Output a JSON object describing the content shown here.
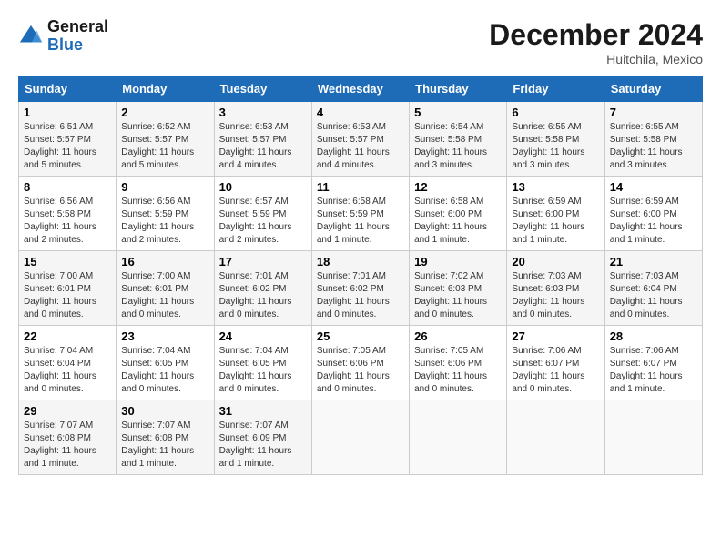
{
  "header": {
    "logo_general": "General",
    "logo_blue": "Blue",
    "month_title": "December 2024",
    "location": "Huitchila, Mexico"
  },
  "weekdays": [
    "Sunday",
    "Monday",
    "Tuesday",
    "Wednesday",
    "Thursday",
    "Friday",
    "Saturday"
  ],
  "weeks": [
    [
      {
        "day": "1",
        "sunrise": "6:51 AM",
        "sunset": "5:57 PM",
        "daylight": "11 hours and 5 minutes."
      },
      {
        "day": "2",
        "sunrise": "6:52 AM",
        "sunset": "5:57 PM",
        "daylight": "11 hours and 5 minutes."
      },
      {
        "day": "3",
        "sunrise": "6:53 AM",
        "sunset": "5:57 PM",
        "daylight": "11 hours and 4 minutes."
      },
      {
        "day": "4",
        "sunrise": "6:53 AM",
        "sunset": "5:57 PM",
        "daylight": "11 hours and 4 minutes."
      },
      {
        "day": "5",
        "sunrise": "6:54 AM",
        "sunset": "5:58 PM",
        "daylight": "11 hours and 3 minutes."
      },
      {
        "day": "6",
        "sunrise": "6:55 AM",
        "sunset": "5:58 PM",
        "daylight": "11 hours and 3 minutes."
      },
      {
        "day": "7",
        "sunrise": "6:55 AM",
        "sunset": "5:58 PM",
        "daylight": "11 hours and 3 minutes."
      }
    ],
    [
      {
        "day": "8",
        "sunrise": "6:56 AM",
        "sunset": "5:58 PM",
        "daylight": "11 hours and 2 minutes."
      },
      {
        "day": "9",
        "sunrise": "6:56 AM",
        "sunset": "5:59 PM",
        "daylight": "11 hours and 2 minutes."
      },
      {
        "day": "10",
        "sunrise": "6:57 AM",
        "sunset": "5:59 PM",
        "daylight": "11 hours and 2 minutes."
      },
      {
        "day": "11",
        "sunrise": "6:58 AM",
        "sunset": "5:59 PM",
        "daylight": "11 hours and 1 minute."
      },
      {
        "day": "12",
        "sunrise": "6:58 AM",
        "sunset": "6:00 PM",
        "daylight": "11 hours and 1 minute."
      },
      {
        "day": "13",
        "sunrise": "6:59 AM",
        "sunset": "6:00 PM",
        "daylight": "11 hours and 1 minute."
      },
      {
        "day": "14",
        "sunrise": "6:59 AM",
        "sunset": "6:00 PM",
        "daylight": "11 hours and 1 minute."
      }
    ],
    [
      {
        "day": "15",
        "sunrise": "7:00 AM",
        "sunset": "6:01 PM",
        "daylight": "11 hours and 0 minutes."
      },
      {
        "day": "16",
        "sunrise": "7:00 AM",
        "sunset": "6:01 PM",
        "daylight": "11 hours and 0 minutes."
      },
      {
        "day": "17",
        "sunrise": "7:01 AM",
        "sunset": "6:02 PM",
        "daylight": "11 hours and 0 minutes."
      },
      {
        "day": "18",
        "sunrise": "7:01 AM",
        "sunset": "6:02 PM",
        "daylight": "11 hours and 0 minutes."
      },
      {
        "day": "19",
        "sunrise": "7:02 AM",
        "sunset": "6:03 PM",
        "daylight": "11 hours and 0 minutes."
      },
      {
        "day": "20",
        "sunrise": "7:03 AM",
        "sunset": "6:03 PM",
        "daylight": "11 hours and 0 minutes."
      },
      {
        "day": "21",
        "sunrise": "7:03 AM",
        "sunset": "6:04 PM",
        "daylight": "11 hours and 0 minutes."
      }
    ],
    [
      {
        "day": "22",
        "sunrise": "7:04 AM",
        "sunset": "6:04 PM",
        "daylight": "11 hours and 0 minutes."
      },
      {
        "day": "23",
        "sunrise": "7:04 AM",
        "sunset": "6:05 PM",
        "daylight": "11 hours and 0 minutes."
      },
      {
        "day": "24",
        "sunrise": "7:04 AM",
        "sunset": "6:05 PM",
        "daylight": "11 hours and 0 minutes."
      },
      {
        "day": "25",
        "sunrise": "7:05 AM",
        "sunset": "6:06 PM",
        "daylight": "11 hours and 0 minutes."
      },
      {
        "day": "26",
        "sunrise": "7:05 AM",
        "sunset": "6:06 PM",
        "daylight": "11 hours and 0 minutes."
      },
      {
        "day": "27",
        "sunrise": "7:06 AM",
        "sunset": "6:07 PM",
        "daylight": "11 hours and 0 minutes."
      },
      {
        "day": "28",
        "sunrise": "7:06 AM",
        "sunset": "6:07 PM",
        "daylight": "11 hours and 1 minute."
      }
    ],
    [
      {
        "day": "29",
        "sunrise": "7:07 AM",
        "sunset": "6:08 PM",
        "daylight": "11 hours and 1 minute."
      },
      {
        "day": "30",
        "sunrise": "7:07 AM",
        "sunset": "6:08 PM",
        "daylight": "11 hours and 1 minute."
      },
      {
        "day": "31",
        "sunrise": "7:07 AM",
        "sunset": "6:09 PM",
        "daylight": "11 hours and 1 minute."
      },
      null,
      null,
      null,
      null
    ]
  ]
}
